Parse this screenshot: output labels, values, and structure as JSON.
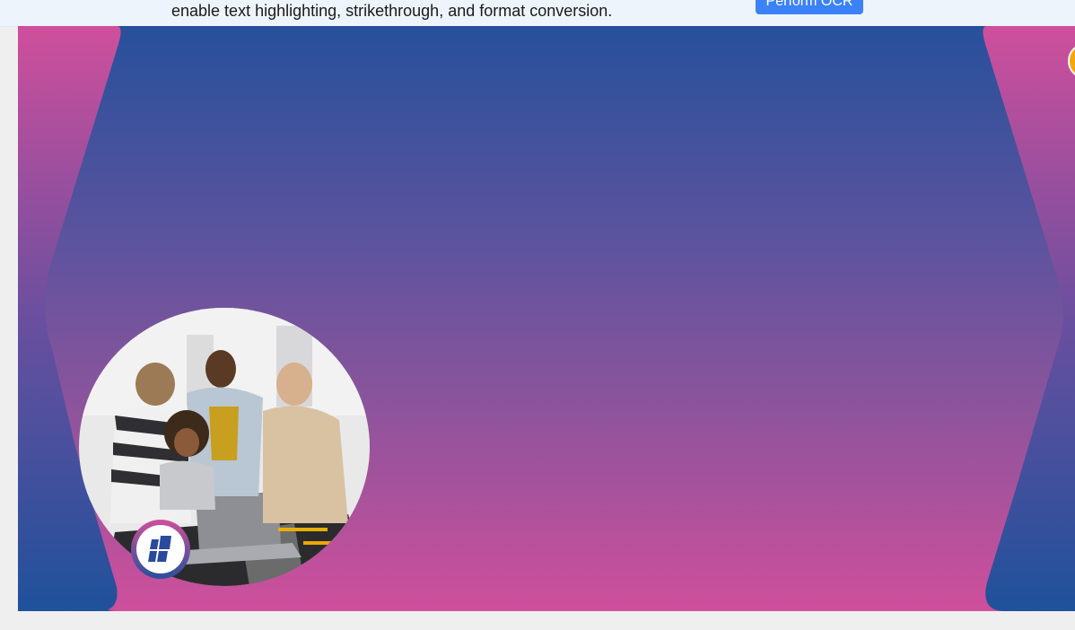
{
  "topbar": {
    "text": "enable text highlighting, strikethrough, and format conversion.",
    "ocr_button_label": "Perform OCR"
  },
  "colors": {
    "brand_blue": "#27509b",
    "brand_pink": "#cf4f9c",
    "button_blue": "#3b82f6",
    "accent_orange": "#f4a70c"
  },
  "icons": {
    "badge": "windows-logo-icon",
    "corner": "avatar-icon"
  }
}
